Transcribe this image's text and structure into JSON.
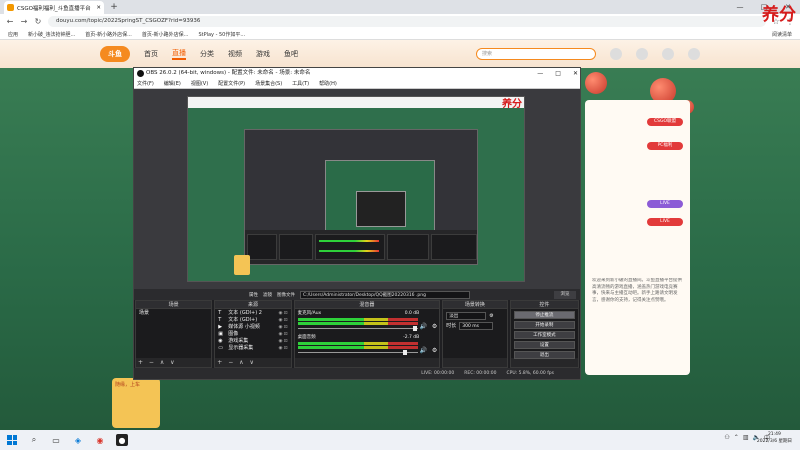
{
  "browser": {
    "tab_title": "CSGO福利福利_斗鱼直播平台",
    "newtab_symbol": "+",
    "window_controls": [
      "—",
      "□",
      "✕"
    ],
    "url": "douyu.com/topic/2022SpringST_CSGOZF?rid=93936",
    "bookmarks": [
      "应用",
      "新小破_违法抢钟胆...",
      "首页-新小路外店保...",
      "首页-新小路外店保...",
      "StPlay - 50作如平..."
    ],
    "reading_list": "阅读清单"
  },
  "douyu": {
    "logo": "斗鱼",
    "nav": [
      "首页",
      "直播",
      "分类",
      "视频",
      "游戏",
      "鱼吧"
    ],
    "search_placeholder": "搜索",
    "right_panel_badges": [
      "CSGO联盟",
      "PC福利",
      "LIVE",
      "LIVE"
    ],
    "right_text": "欢迎来到新小破的直播间。斗鱼直播平台提供高清流畅的游戏直播，涵盖热门游戏电竞赛事，快来与主播互动吧。新手上路请文明发言，感谢你的支持，记得关注点赞哦。",
    "left_card_title": "随缘，上车",
    "watermark": "养分"
  },
  "obs": {
    "title": "OBS 26.0.2 (64-bit, windows) - 配置文件: 未命名 - 场景: 未命名",
    "menu": [
      "文件(F)",
      "编辑(E)",
      "视图(V)",
      "配置文件(P)",
      "场景集合(S)",
      "工具(T)",
      "帮助(H)"
    ],
    "window_controls": [
      "—",
      "□",
      "✕"
    ],
    "preview_watermark": "养分",
    "path_bar": {
      "prop_label": "属性",
      "filter_label": "滤镜",
      "file_label": "图像文件",
      "path": "C:/Users/Administrator/Desktop/QQ截图20220316 .png",
      "browse": "浏览"
    },
    "docks": {
      "scenes": {
        "title": "场景",
        "items": [
          "场景"
        ]
      },
      "sources": {
        "title": "来源",
        "items": [
          {
            "icon": "T",
            "name": "文本 (GDI+) 2"
          },
          {
            "icon": "T",
            "name": "文本 (GDI+)"
          },
          {
            "icon": "▶",
            "name": "媒体源 小视频"
          },
          {
            "icon": "▣",
            "name": "图像"
          },
          {
            "icon": "◉",
            "name": "游戏采集"
          },
          {
            "icon": "▭",
            "name": "显示器采集"
          }
        ]
      },
      "mixer": {
        "title": "混音器",
        "tracks": [
          {
            "name": "麦克风/Aux",
            "db": "0.0 dB"
          },
          {
            "name": "桌面音频",
            "db": "-2.7 dB"
          }
        ]
      },
      "transitions": {
        "title": "场景转换",
        "type": "淡出",
        "duration_label": "时长",
        "duration": "300 ms"
      },
      "controls": {
        "title": "控件",
        "buttons": [
          "停止推流",
          "开始录制",
          "工作室模式",
          "设置",
          "退出"
        ]
      }
    },
    "status": {
      "live": "LIVE: 00:00:00",
      "rec": "REC: 00:00:00",
      "cpu": "CPU: 5.8%, 60.00 fps"
    },
    "dock_footer": "+ − ∧ ∨"
  },
  "taskbar": {
    "search_icon": "⌕",
    "time": "21:49",
    "date": "2022/3/6 星期日"
  }
}
